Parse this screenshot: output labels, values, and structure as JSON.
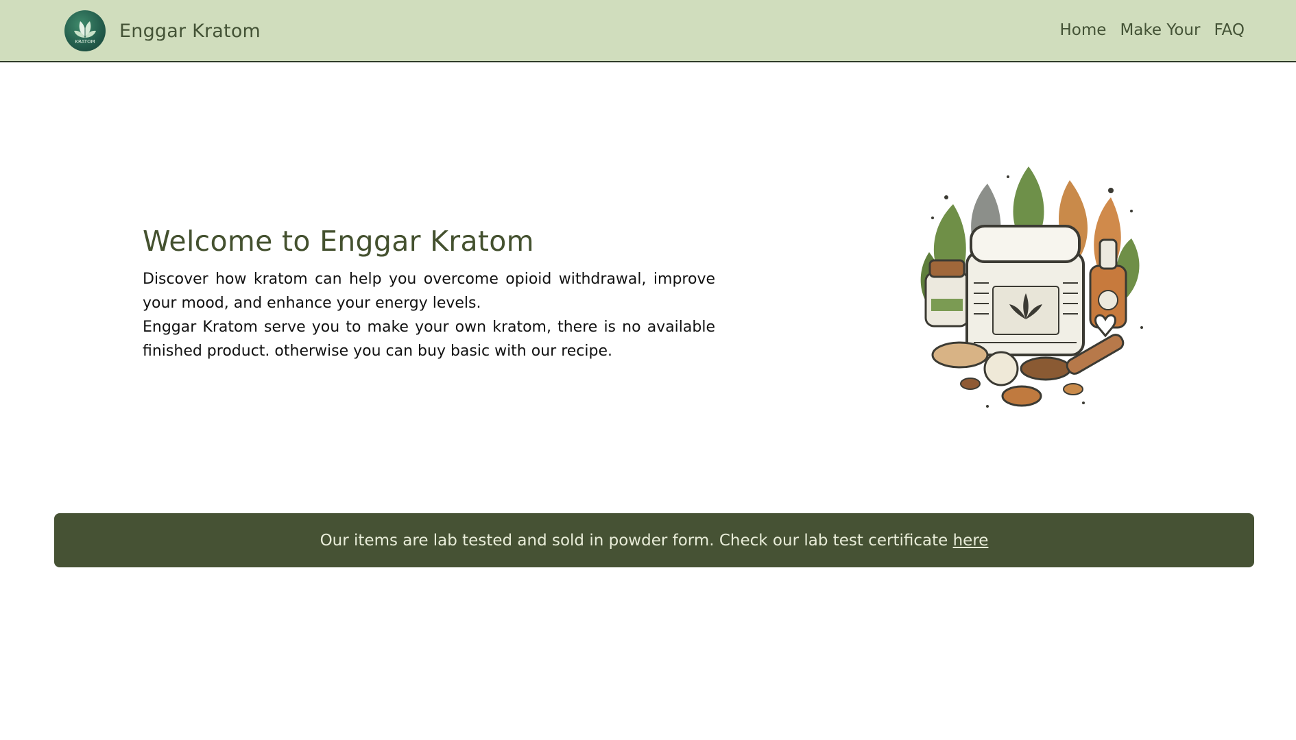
{
  "brand": {
    "logo_text": "KRATOM",
    "name": "Enggar Kratom"
  },
  "nav": {
    "items": [
      "Home",
      "Make Your",
      "FAQ"
    ]
  },
  "hero": {
    "title": "Welcome to Enggar Kratom",
    "paragraph1": "Discover how kratom can help you overcome opioid withdrawal, improve your mood, and enhance your energy levels.",
    "paragraph2": "Enggar Kratom serve you to make your own kratom, there is no available finished product. otherwise you can buy basic with our recipe."
  },
  "banner": {
    "text": "Our items are lab tested and sold in powder form. Check our lab test certificate ",
    "link_label": "here"
  },
  "colors": {
    "navbar_bg": "#d0ddbd",
    "brand_text": "#445336",
    "banner_bg": "#465234",
    "banner_text": "#e8ecd8"
  },
  "icons": [
    "leaf-icon",
    "product-illustration"
  ]
}
